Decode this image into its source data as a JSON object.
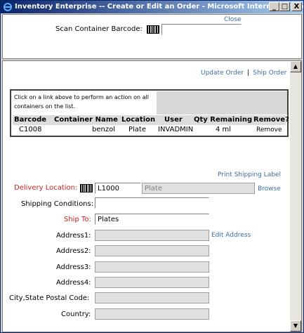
{
  "window": {
    "title": "Inventory Enterprise -- Create or Edit an Order - Microsoft Internet Explorer",
    "minimize": "_",
    "maximize": "□",
    "close": "X"
  },
  "top": {
    "close_link": "Close",
    "scan_label": "Scan Container Barcode:",
    "scan_value": ""
  },
  "actions": {
    "update_order": "Update Order",
    "separator": "|",
    "ship_order": "Ship Order"
  },
  "info": {
    "message": "Click on a link above to perform an action on all containers on the list."
  },
  "table": {
    "headers": [
      "Barcode",
      "Container Name",
      "Location",
      "User",
      "Qty Remaining",
      "Remove?"
    ],
    "rows": [
      {
        "barcode": "C1008",
        "container_name": "benzol",
        "location": "Plate",
        "user": "INVADMIN",
        "qty": "4 ml",
        "remove": "Remove"
      }
    ]
  },
  "form": {
    "print_shipping_label": "Print Shipping Label",
    "delivery_location_label": "Delivery Location:",
    "delivery_location_code": "L1000",
    "delivery_location_name": "Plate",
    "browse": "Browse",
    "shipping_conditions_label": "Shipping Conditions:",
    "shipping_conditions_value": "",
    "ship_to_label": "Ship To:",
    "ship_to_value": "Plates",
    "address1_label": "Address1:",
    "edit_address": "Edit Address",
    "address2_label": "Address2:",
    "address3_label": "Address3:",
    "address4_label": "Address4:",
    "city_label": "City,State Postal Code:",
    "country_label": "Country:"
  },
  "colors": {
    "link": "#3a6ea5",
    "required_label": "#cc2222",
    "titlebar": "#0a246a"
  }
}
